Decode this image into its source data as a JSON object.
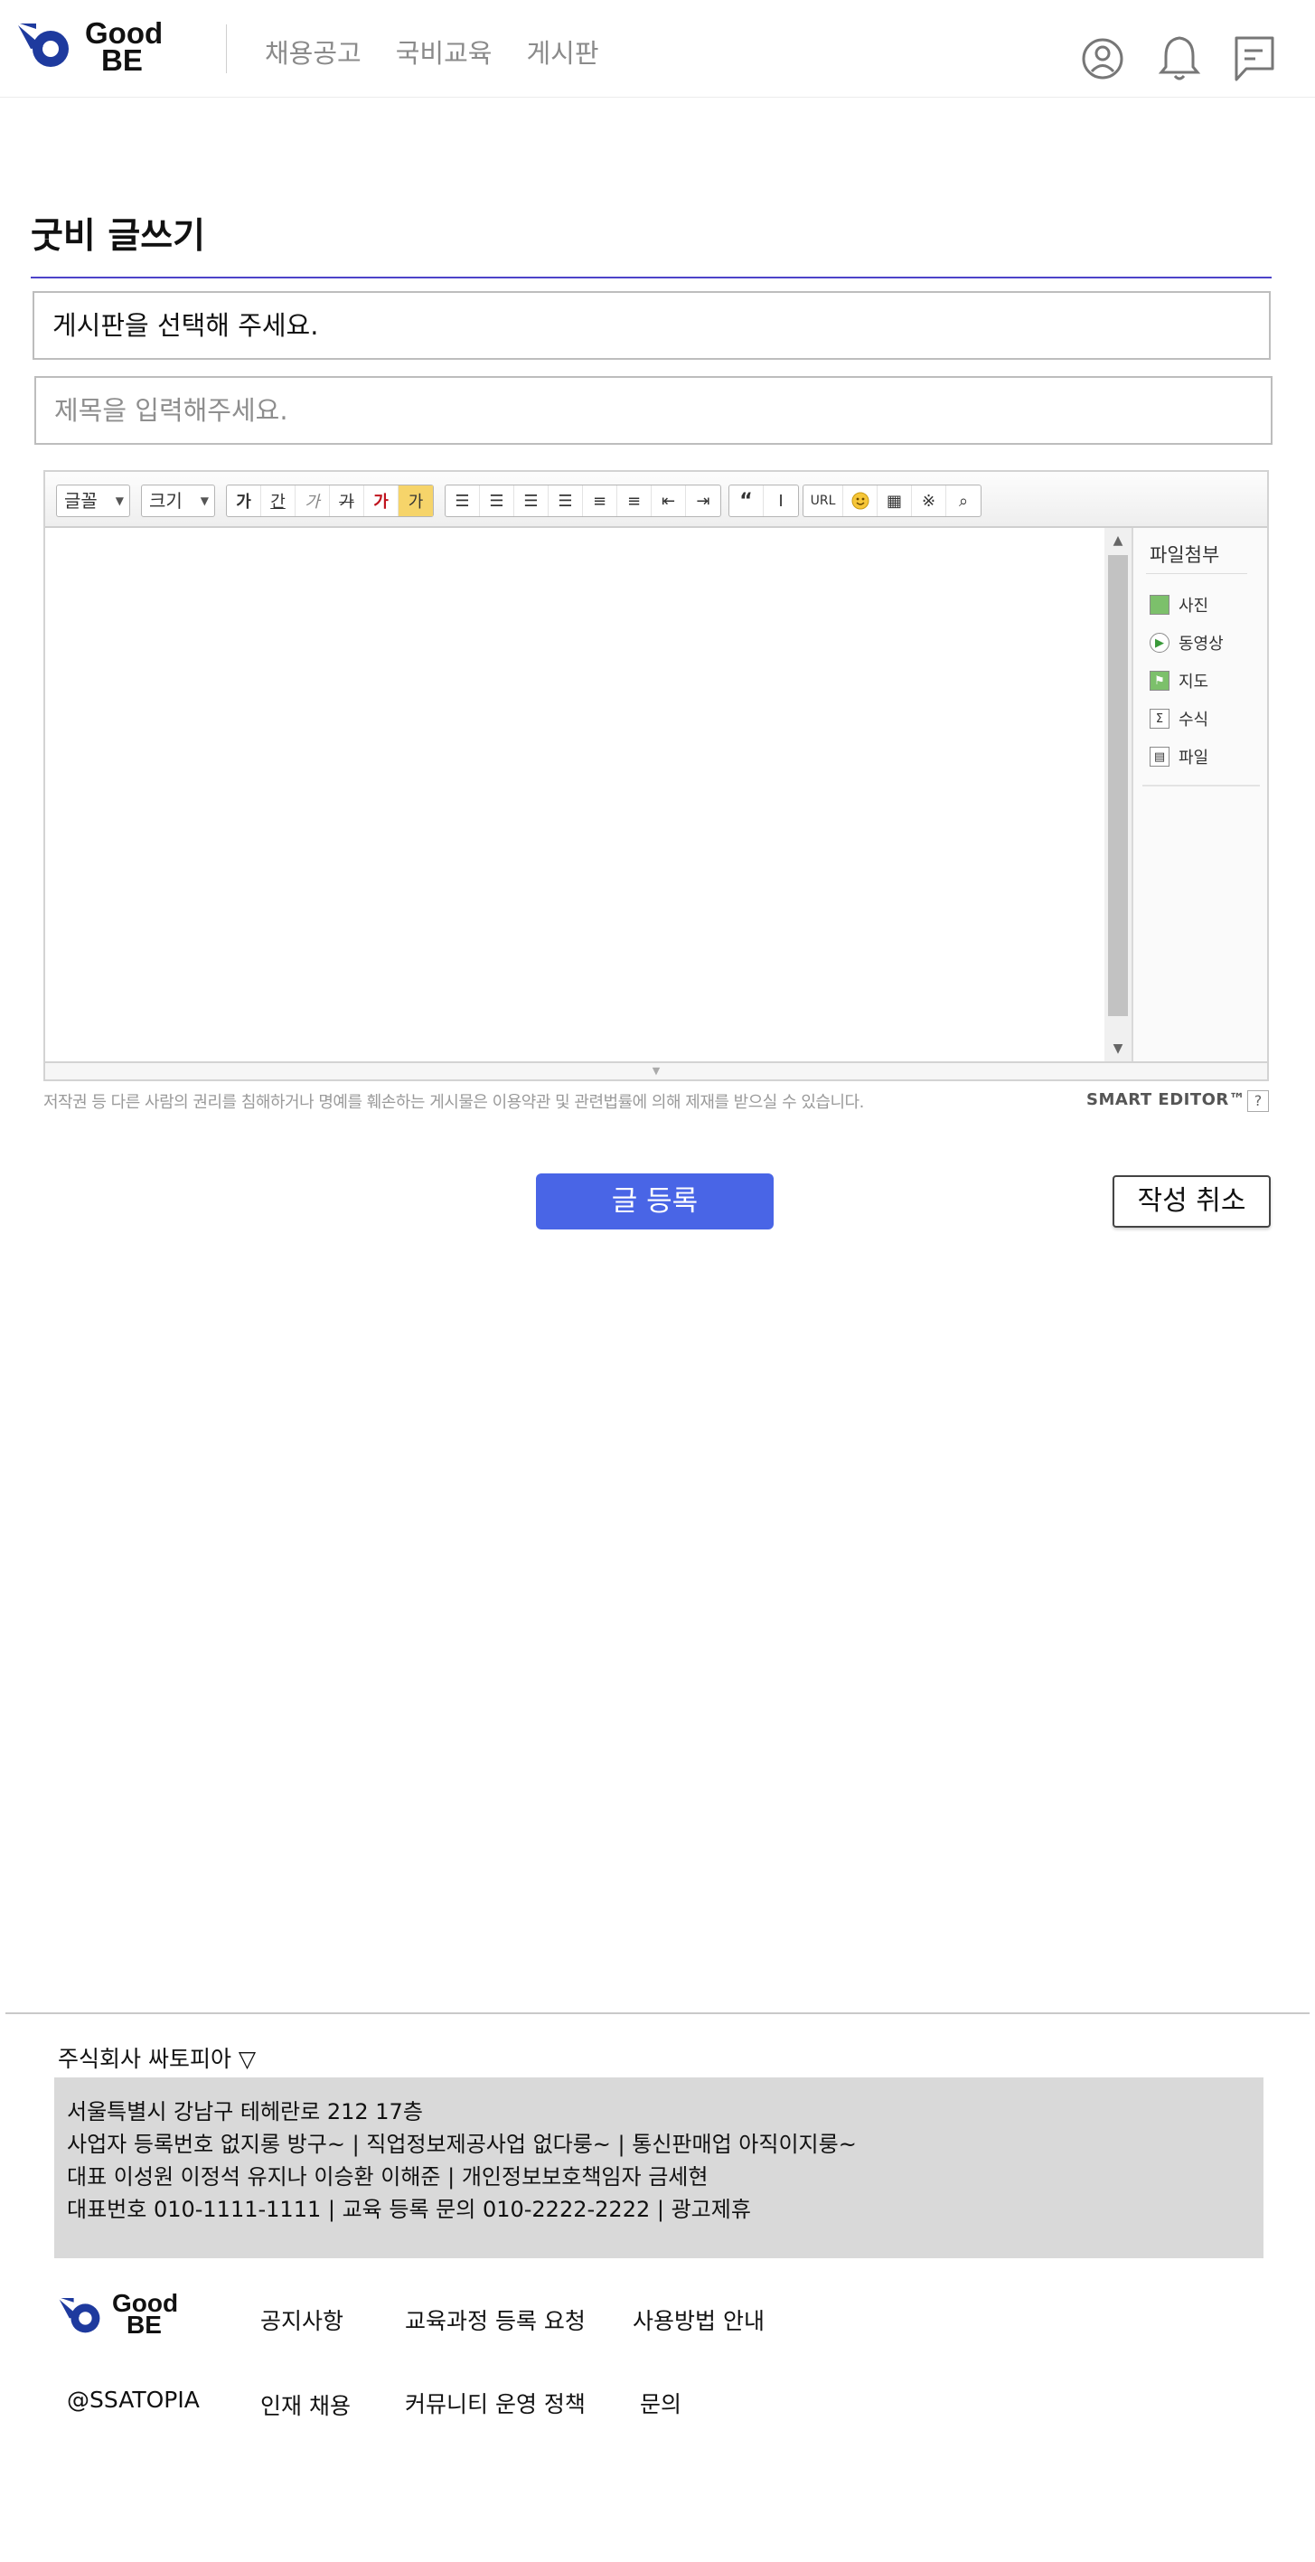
{
  "header": {
    "logo": {
      "line1": "Good",
      "line2": "BE"
    },
    "nav": [
      "채용공고",
      "국비교육",
      "게시판"
    ]
  },
  "page": {
    "title": "굿비 글쓰기",
    "board_select": "게시판을 선택해 주세요.",
    "title_placeholder": "제목을 입력해주세요."
  },
  "editor": {
    "font_dropdown": "글꼴",
    "size_dropdown": "크기",
    "attach_title": "파일첨부",
    "attach_items": [
      "사진",
      "동영상",
      "지도",
      "수식",
      "파일"
    ],
    "notice": "저작권 등 다른 사람의 권리를 침해하거나 명예를 훼손하는 게시물은 이용약관 및 관련법률에 의해 제재를 받으실 수 있습니다.",
    "brand": "SMART EDITOR™",
    "help": "?",
    "url_label": "URL"
  },
  "actions": {
    "submit": "글 등록",
    "cancel": "작성 취소"
  },
  "footer": {
    "company": "주식회사 싸토피아 ▽",
    "info_lines": [
      "서울특별시 강남구 테헤란로 212 17층",
      "사업자 등록번호  없지롱 방구~ | 직업정보제공사업 없다룽~ | 통신판매업 아직이지룽~",
      "대표 이성원 이정석 유지나 이승환 이해준 | 개인정보보호책임자 금세현",
      "대표번호 010-1111-1111 | 교육 등록 문의 010-2222-2222 | 광고제휴"
    ],
    "logo": {
      "line1": "Good",
      "line2": "BE"
    },
    "links_row1": [
      "공지사항",
      "교육과정 등록 요청",
      "사용방법 안내"
    ],
    "handle": "@SSATOPIA",
    "links_row2": [
      "인재 채용",
      "커뮤니티 운영 정책",
      "문의"
    ]
  },
  "colors": {
    "accent": "#4965e6",
    "title_line": "#4d43c9",
    "logo_blue": "#1e3a9e"
  }
}
